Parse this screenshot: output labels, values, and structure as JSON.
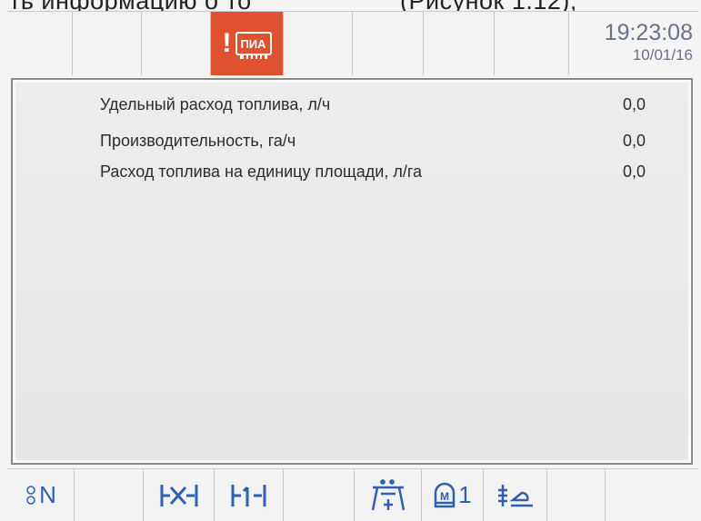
{
  "caption": {
    "left": "ть информацию о то",
    "right": "(Рисунок 1.12);"
  },
  "status": {
    "alarm_label": "ПИА",
    "time": "19:23:08",
    "date": "10/01/16"
  },
  "panel": {
    "rows": [
      {
        "label": "Удельный расход топлива, л/ч",
        "value": "0,0"
      },
      {
        "label": "Производительность, га/ч",
        "value": "0,0"
      },
      {
        "label": "Расход топлива на единицу площади, л/га",
        "value": "0,0"
      }
    ]
  },
  "bottom": {
    "gear_label": "N",
    "motor_index": "1"
  },
  "colors": {
    "alarm": "#e0512f",
    "icon": "#2f5fb0",
    "clock": "#6a7288"
  }
}
